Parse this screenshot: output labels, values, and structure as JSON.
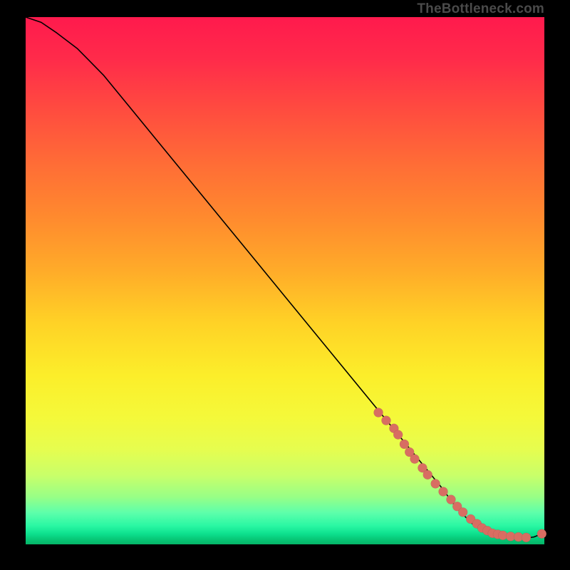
{
  "attribution": "TheBottleneck.com",
  "chart_data": {
    "type": "line",
    "title": "",
    "xlabel": "",
    "ylabel": "",
    "xlim": [
      0,
      100
    ],
    "ylim": [
      0,
      100
    ],
    "series": [
      {
        "name": "bottleneck-curve",
        "x": [
          0,
          3,
          6,
          10,
          15,
          20,
          25,
          30,
          35,
          40,
          45,
          50,
          55,
          60,
          65,
          70,
          75,
          80,
          83,
          86,
          88,
          90,
          92,
          94,
          96,
          98,
          100
        ],
        "y": [
          100,
          99,
          97,
          94,
          89,
          83,
          77,
          71,
          65,
          59,
          53,
          47,
          41,
          35,
          29,
          23,
          17,
          11,
          7,
          4,
          2.5,
          1.8,
          1.4,
          1.2,
          1.1,
          1.4,
          2.2
        ]
      }
    ],
    "markers": {
      "name": "highlighted-points",
      "x": [
        68,
        69.5,
        71,
        71.8,
        73,
        74,
        75,
        76.5,
        77.5,
        79,
        80.5,
        82,
        83.2,
        84.3,
        85.8,
        87,
        88,
        89,
        90,
        91,
        92,
        93.5,
        95,
        96.5,
        99.5
      ],
      "y": [
        25,
        23.5,
        22,
        20.8,
        19,
        17.5,
        16.2,
        14.5,
        13.2,
        11.5,
        10,
        8.5,
        7.2,
        6.1,
        4.8,
        3.9,
        3.1,
        2.6,
        2.1,
        1.9,
        1.7,
        1.5,
        1.4,
        1.3,
        2.0
      ]
    }
  }
}
